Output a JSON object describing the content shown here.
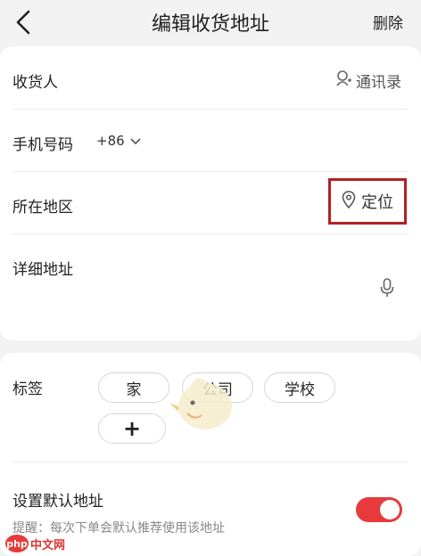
{
  "nav": {
    "title": "编辑收货地址",
    "delete_label": "删除"
  },
  "form": {
    "recipient_label": "收货人",
    "contacts_label": "通讯录",
    "phone_label": "手机号码",
    "country_code": "+86",
    "region_label": "所在地区",
    "locate_label": "定位",
    "address_label": "详细地址"
  },
  "tags": {
    "label": "标签",
    "options": [
      "家",
      "公司",
      "学校"
    ],
    "add_label": "+"
  },
  "default_address": {
    "label": "设置默认地址",
    "hint": "提醒：每次下单会默认推荐使用该地址",
    "enabled": true
  },
  "watermark": {
    "logo": "php",
    "text": "中文网"
  },
  "colors": {
    "accent": "#e8393d",
    "highlight_box": "#b32024",
    "background": "#f2f2f2"
  },
  "icons": [
    "back-arrow-icon",
    "contacts-icon",
    "chevron-down-icon",
    "location-pin-icon",
    "microphone-icon",
    "toggle-switch"
  ]
}
